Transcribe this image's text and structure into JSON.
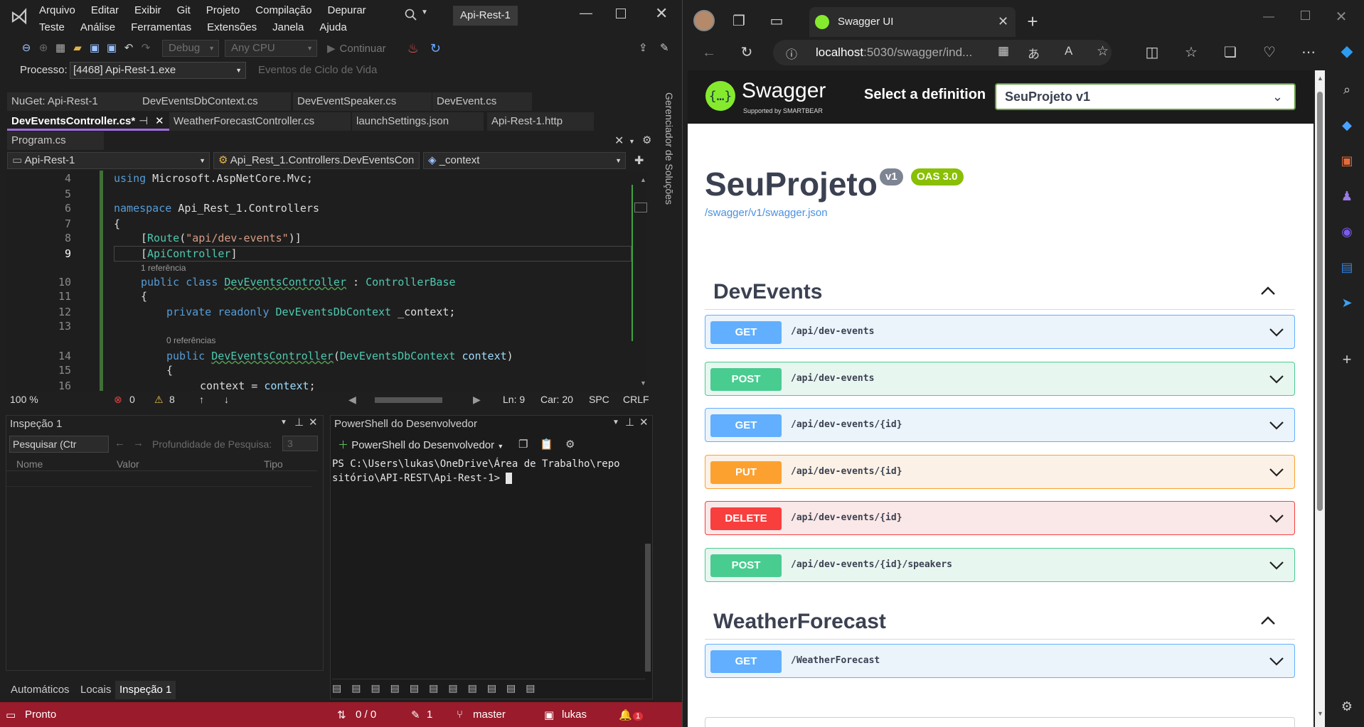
{
  "vs": {
    "menu_row1": [
      "Arquivo",
      "Editar",
      "Exibir",
      "Git",
      "Projeto",
      "Compilação",
      "Depurar"
    ],
    "menu_row2": [
      "Teste",
      "Análise",
      "Ferramentas",
      "Extensões",
      "Janela",
      "Ajuda"
    ],
    "title_badge": "Api-Rest-1",
    "toolbar": {
      "config": "Debug",
      "platform": "Any CPU",
      "continue": "Continuar"
    },
    "process_label": "Processo:",
    "process_value": "[4468] Api-Rest-1.exe",
    "lifecycle": "Eventos de Ciclo de Vida",
    "solution_explorer": "Gerenciador de Soluções",
    "tabs_row1": [
      "NuGet: Api-Rest-1",
      "DevEventsDbContext.cs",
      "DevEventSpeaker.cs",
      "DevEvent.cs"
    ],
    "tabs_row2": [
      "DevEventsController.cs*",
      "WeatherForecastController.cs",
      "launchSettings.json",
      "Api-Rest-1.http"
    ],
    "tabs_row3": [
      "Program.cs"
    ],
    "nav": {
      "project": "Api-Rest-1",
      "class": "Api_Rest_1.Controllers.DevEventsCon",
      "member": "_context"
    },
    "line_numbers": [
      "4",
      "5",
      "6",
      "7",
      "8",
      "9",
      "",
      "10",
      "11",
      "12",
      "13",
      "",
      "14",
      "15",
      "16"
    ],
    "hints": {
      "refs1": "1 referência",
      "refs0": "0 referências"
    },
    "editor_status": {
      "zoom": "100 %",
      "errors": "0",
      "warnings": "8",
      "ln": "Ln: 9",
      "col": "Car: 20",
      "spc": "SPC",
      "crlf": "CRLF"
    },
    "watch": {
      "title": "Inspeção 1",
      "search": "Pesquisar (Ctr",
      "depth_label": "Profundidade de Pesquisa:",
      "depth": "3",
      "cols": [
        "Nome",
        "Valor",
        "Tipo"
      ]
    },
    "bottom_tabs": [
      "Automáticos",
      "Locais",
      "Inspeção 1"
    ],
    "ps": {
      "title": "PowerShell do Desenvolvedor",
      "button": "PowerShell do Desenvolvedor",
      "line1": "PS C:\\Users\\lukas\\OneDrive\\Área de Trabalho\\repo",
      "line2": "sitório\\API-REST\\Api-Rest-1>"
    },
    "statusbar": {
      "ready": "Pronto",
      "sync": "0 / 0",
      "pushes": "1",
      "branch": "master",
      "user": "lukas",
      "notif": "1"
    }
  },
  "edge": {
    "tab_title": "Swagger UI",
    "url_host": "localhost",
    "url_rest": ":5030/swagger/ind...",
    "swagger": {
      "brand": "Swagger",
      "brand_sub": "Supported by SMARTBEAR",
      "select_label": "Select a definition",
      "select_value": "SeuProjeto v1",
      "title": "SeuProjeto",
      "version": "v1",
      "oas": "OAS 3.0",
      "link": "/swagger/v1/swagger.json",
      "sections": [
        {
          "name": "DevEvents",
          "ops": [
            {
              "method": "GET",
              "path": "/api/dev-events"
            },
            {
              "method": "POST",
              "path": "/api/dev-events"
            },
            {
              "method": "GET",
              "path": "/api/dev-events/{id}"
            },
            {
              "method": "PUT",
              "path": "/api/dev-events/{id}"
            },
            {
              "method": "DELETE",
              "path": "/api/dev-events/{id}"
            },
            {
              "method": "POST",
              "path": "/api/dev-events/{id}/speakers"
            }
          ]
        },
        {
          "name": "WeatherForecast",
          "ops": [
            {
              "method": "GET",
              "path": "/WeatherForecast"
            }
          ]
        }
      ]
    }
  },
  "colors": {
    "get": "#61affe",
    "post": "#49cc90",
    "put": "#fca130",
    "delete": "#f93e3e",
    "vs_status": "#9a1b2b"
  }
}
